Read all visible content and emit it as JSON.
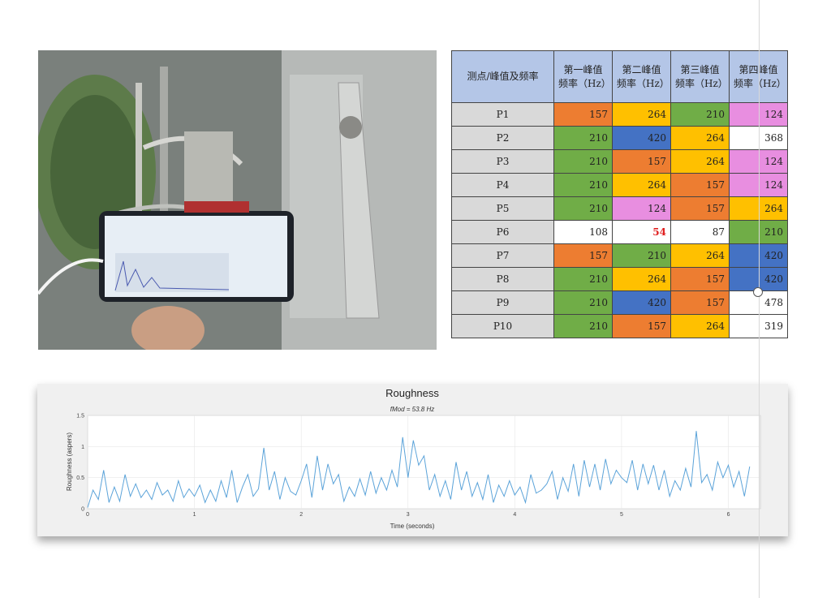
{
  "table": {
    "headers": [
      "测点/峰值及频率",
      "第一峰值\n频率（Hz）",
      "第二峰值\n频率（Hz）",
      "第三峰值\n频率（Hz）",
      "第四峰值\n频率（Hz）"
    ],
    "rows": [
      {
        "point": "P1",
        "values": [
          "157",
          "264",
          "210",
          "124"
        ],
        "colors": [
          "#ed7d31",
          "#ffc000",
          "#70ad47",
          "#e88ee0"
        ]
      },
      {
        "point": "P2",
        "values": [
          "210",
          "420",
          "264",
          "368"
        ],
        "colors": [
          "#70ad47",
          "#4472c4",
          "#ffc000",
          "#ffffff"
        ]
      },
      {
        "point": "P3",
        "values": [
          "210",
          "157",
          "264",
          "124"
        ],
        "colors": [
          "#70ad47",
          "#ed7d31",
          "#ffc000",
          "#e88ee0"
        ]
      },
      {
        "point": "P4",
        "values": [
          "210",
          "264",
          "157",
          "124"
        ],
        "colors": [
          "#70ad47",
          "#ffc000",
          "#ed7d31",
          "#e88ee0"
        ]
      },
      {
        "point": "P5",
        "values": [
          "210",
          "124",
          "157",
          "264"
        ],
        "colors": [
          "#70ad47",
          "#e88ee0",
          "#ed7d31",
          "#ffc000"
        ]
      },
      {
        "point": "P6",
        "values": [
          "108",
          "54",
          "87",
          "210"
        ],
        "colors": [
          "#ffffff",
          "#ffffff",
          "#ffffff",
          "#70ad47"
        ]
      },
      {
        "point": "P7",
        "values": [
          "157",
          "210",
          "264",
          "420"
        ],
        "colors": [
          "#ed7d31",
          "#70ad47",
          "#ffc000",
          "#4472c4"
        ]
      },
      {
        "point": "P8",
        "values": [
          "210",
          "264",
          "157",
          "420"
        ],
        "colors": [
          "#70ad47",
          "#ffc000",
          "#ed7d31",
          "#4472c4"
        ]
      },
      {
        "point": "P9",
        "values": [
          "210",
          "420",
          "157",
          "478"
        ],
        "colors": [
          "#70ad47",
          "#4472c4",
          "#ed7d31",
          "#ffffff"
        ]
      },
      {
        "point": "P10",
        "values": [
          "210",
          "157",
          "264",
          "319"
        ],
        "colors": [
          "#70ad47",
          "#ed7d31",
          "#ffc000",
          "#ffffff"
        ]
      }
    ]
  },
  "chart_data": {
    "type": "line",
    "title": "Roughness",
    "subtitle": "fMod = 53.8 Hz",
    "xlabel": "Time (seconds)",
    "ylabel": "Roughness (aspers)",
    "xlim": [
      0,
      6.3
    ],
    "ylim": [
      0,
      1.5
    ],
    "xticks": [
      "0",
      "1",
      "2",
      "3",
      "4",
      "5",
      "6"
    ],
    "yticks": [
      "0",
      "0.5",
      "1",
      "1.5"
    ],
    "grid": true,
    "line_color": "#5ba3d9",
    "x": [
      0,
      0.05,
      0.1,
      0.15,
      0.2,
      0.25,
      0.3,
      0.35,
      0.4,
      0.45,
      0.5,
      0.55,
      0.6,
      0.65,
      0.7,
      0.75,
      0.8,
      0.85,
      0.9,
      0.95,
      1.0,
      1.05,
      1.1,
      1.15,
      1.2,
      1.25,
      1.3,
      1.35,
      1.4,
      1.45,
      1.5,
      1.55,
      1.6,
      1.65,
      1.7,
      1.75,
      1.8,
      1.85,
      1.9,
      1.95,
      2.0,
      2.05,
      2.1,
      2.15,
      2.2,
      2.25,
      2.3,
      2.35,
      2.4,
      2.45,
      2.5,
      2.55,
      2.6,
      2.65,
      2.7,
      2.75,
      2.8,
      2.85,
      2.9,
      2.95,
      3.0,
      3.05,
      3.1,
      3.15,
      3.2,
      3.25,
      3.3,
      3.35,
      3.4,
      3.45,
      3.5,
      3.55,
      3.6,
      3.65,
      3.7,
      3.75,
      3.8,
      3.85,
      3.9,
      3.95,
      4.0,
      4.05,
      4.1,
      4.15,
      4.2,
      4.25,
      4.3,
      4.35,
      4.4,
      4.45,
      4.5,
      4.55,
      4.6,
      4.65,
      4.7,
      4.75,
      4.8,
      4.85,
      4.9,
      4.95,
      5.0,
      5.05,
      5.1,
      5.15,
      5.2,
      5.25,
      5.3,
      5.35,
      5.4,
      5.45,
      5.5,
      5.55,
      5.6,
      5.65,
      5.7,
      5.75,
      5.8,
      5.85,
      5.9,
      5.95,
      6.0,
      6.05,
      6.1,
      6.15,
      6.2,
      6.25,
      6.3
    ],
    "y": [
      0.02,
      0.3,
      0.15,
      0.62,
      0.1,
      0.35,
      0.12,
      0.55,
      0.2,
      0.4,
      0.18,
      0.3,
      0.15,
      0.42,
      0.22,
      0.3,
      0.12,
      0.45,
      0.18,
      0.32,
      0.2,
      0.38,
      0.1,
      0.3,
      0.12,
      0.45,
      0.18,
      0.62,
      0.1,
      0.35,
      0.55,
      0.2,
      0.32,
      0.98,
      0.3,
      0.6,
      0.15,
      0.5,
      0.28,
      0.22,
      0.45,
      0.72,
      0.18,
      0.85,
      0.3,
      0.72,
      0.4,
      0.55,
      0.12,
      0.35,
      0.2,
      0.48,
      0.22,
      0.6,
      0.25,
      0.5,
      0.3,
      0.62,
      0.35,
      1.15,
      0.5,
      1.1,
      0.7,
      0.85,
      0.3,
      0.55,
      0.2,
      0.45,
      0.15,
      0.75,
      0.3,
      0.6,
      0.2,
      0.42,
      0.15,
      0.55,
      0.1,
      0.38,
      0.2,
      0.45,
      0.22,
      0.35,
      0.1,
      0.55,
      0.25,
      0.3,
      0.4,
      0.6,
      0.15,
      0.5,
      0.28,
      0.72,
      0.2,
      0.78,
      0.35,
      0.72,
      0.3,
      0.8,
      0.4,
      0.62,
      0.5,
      0.42,
      0.78,
      0.3,
      0.72,
      0.4,
      0.7,
      0.3,
      0.62,
      0.2,
      0.45,
      0.3,
      0.65,
      0.35,
      1.25,
      0.42,
      0.55,
      0.3,
      0.75,
      0.5,
      0.7,
      0.35,
      0.6,
      0.2,
      0.68
    ]
  }
}
